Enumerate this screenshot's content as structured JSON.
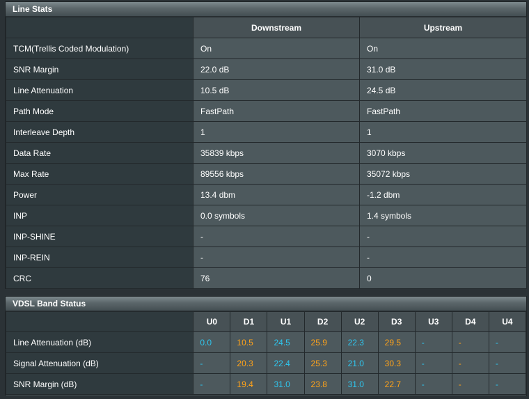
{
  "line_stats": {
    "title": "Line Stats",
    "headers": [
      "Downstream",
      "Upstream"
    ],
    "rows": [
      {
        "label": "TCM(Trellis Coded Modulation)",
        "down": "On",
        "up": "On"
      },
      {
        "label": "SNR Margin",
        "down": "22.0 dB",
        "up": "31.0 dB"
      },
      {
        "label": "Line Attenuation",
        "down": "10.5 dB",
        "up": "24.5 dB"
      },
      {
        "label": "Path Mode",
        "down": "FastPath",
        "up": "FastPath"
      },
      {
        "label": "Interleave Depth",
        "down": "1",
        "up": "1"
      },
      {
        "label": "Data Rate",
        "down": "35839 kbps",
        "up": "3070 kbps"
      },
      {
        "label": "Max Rate",
        "down": "89556 kbps",
        "up": "35072 kbps"
      },
      {
        "label": "Power",
        "down": "13.4 dbm",
        "up": "-1.2 dbm"
      },
      {
        "label": "INP",
        "down": "0.0 symbols",
        "up": "1.4 symbols"
      },
      {
        "label": "INP-SHINE",
        "down": "-",
        "up": "-"
      },
      {
        "label": "INP-REIN",
        "down": "-",
        "up": "-"
      },
      {
        "label": "CRC",
        "down": "76",
        "up": "0"
      }
    ]
  },
  "vdsl_band": {
    "title": "VDSL Band Status",
    "bands": [
      "U0",
      "D1",
      "U1",
      "D2",
      "U2",
      "D3",
      "U3",
      "D4",
      "U4"
    ],
    "colors": {
      "upstream": "#2ec7f0",
      "downstream": "#ffa31a"
    },
    "rows": [
      {
        "label": "Line Attenuation (dB)",
        "values": [
          "0.0",
          "10.5",
          "24.5",
          "25.9",
          "22.3",
          "29.5",
          "-",
          "-",
          "-"
        ]
      },
      {
        "label": "Signal Attenuation (dB)",
        "values": [
          "-",
          "20.3",
          "22.4",
          "25.3",
          "21.0",
          "30.3",
          "-",
          "-",
          "-"
        ]
      },
      {
        "label": "SNR Margin (dB)",
        "values": [
          "-",
          "19.4",
          "31.0",
          "23.8",
          "31.0",
          "22.7",
          "-",
          "-",
          "-"
        ]
      }
    ]
  }
}
